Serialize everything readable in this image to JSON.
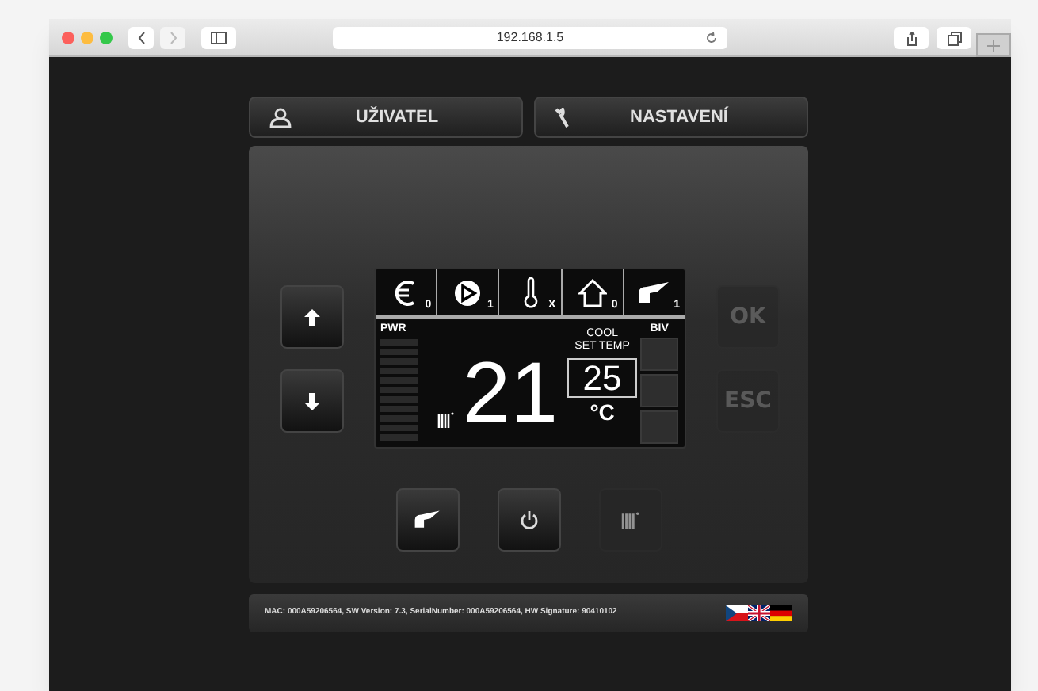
{
  "browser": {
    "url": "192.168.1.5"
  },
  "nav_buttons": [
    {
      "kind": "user",
      "label": "UŽIVATEL"
    },
    {
      "kind": "wrench",
      "label": "NASTAVENÍ"
    }
  ],
  "side_buttons_left": [
    {
      "kind": "up",
      "disabled": false
    },
    {
      "kind": "down",
      "disabled": false
    }
  ],
  "side_buttons_right": [
    {
      "label": "OK",
      "disabled": true
    },
    {
      "label": "ESC",
      "disabled": true
    }
  ],
  "display": {
    "status_icons": [
      {
        "kind": "euro",
        "value": "0"
      },
      {
        "kind": "pump",
        "value": "1"
      },
      {
        "kind": "thermometer",
        "value": "X"
      },
      {
        "kind": "house",
        "value": "0"
      },
      {
        "kind": "tap",
        "value": "1"
      }
    ],
    "pwr_label": "PWR",
    "biv_label": "BIV",
    "temperature": "21",
    "mode": "COOL",
    "set_label": "SET TEMP",
    "set_temp": "25",
    "unit": "°C"
  },
  "bottom_buttons": [
    {
      "kind": "tap",
      "disabled": false
    },
    {
      "kind": "power",
      "disabled": false
    },
    {
      "kind": "radiator",
      "disabled": true
    }
  ],
  "footer": {
    "info": "MAC: 000A59206564, SW Version: 7.3, SerialNumber: 000A59206564, HW Signature: 90410102",
    "languages": [
      {
        "kind": "cz"
      },
      {
        "kind": "gb"
      },
      {
        "kind": "de"
      }
    ]
  }
}
